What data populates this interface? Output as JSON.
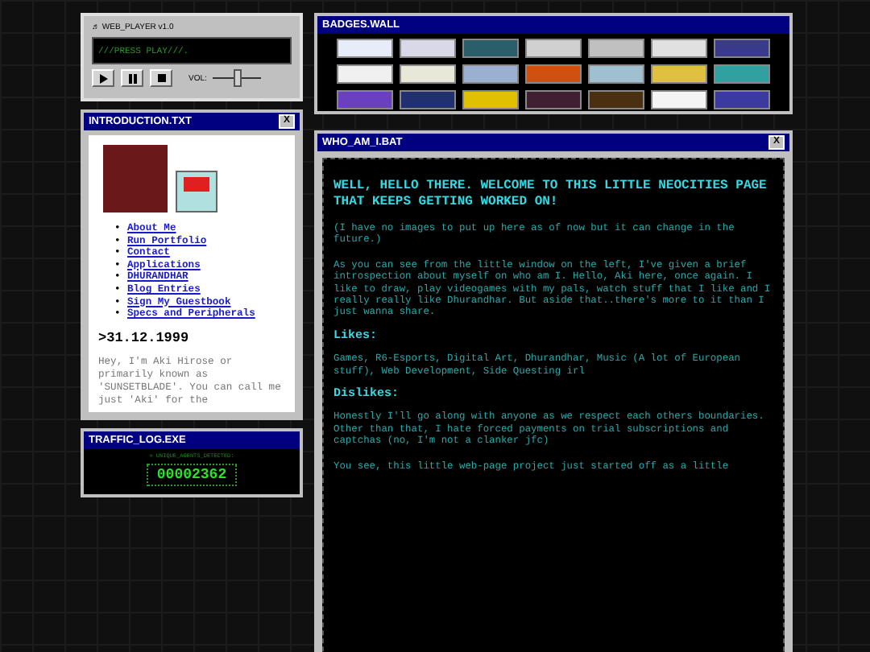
{
  "player": {
    "title": "♬ WEB_PLAYER v1.0",
    "display": "///PRESS PLAY///.",
    "volume_label": "VOL:",
    "volume": {
      "level": 0.5
    }
  },
  "intro": {
    "title": "INTRODUCTION.TXT",
    "close": "X",
    "links": [
      {
        "bullet": "•",
        "label": "About Me"
      },
      {
        "bullet": "•",
        "label": "Run Portfolio"
      },
      {
        "bullet": "•",
        "label": "Contact"
      },
      {
        "bullet": "•",
        "label": "Applications"
      },
      {
        "bullet": "•",
        "label": "DHURANDHAR"
      },
      {
        "bullet": "•",
        "label": "Blog Entries"
      },
      {
        "bullet": "•",
        "label": "Sign My Guestbook"
      },
      {
        "bullet": "•",
        "label": "Specs and Peripherals"
      }
    ],
    "date": ">31.12.1999",
    "text": "Hey, I'm Aki Hirose or primarily known as 'SUNSETBLADE'. You can call me just 'Aki' for the"
  },
  "traffic": {
    "title": "TRAFFIC_LOG.EXE",
    "caption": "» UNIQUE_AGENTS_DETECTED:",
    "count": "00002362"
  },
  "badges": {
    "title": "BADGES.WALL",
    "items": [
      {
        "color": "#e8ecf8"
      },
      {
        "color": "#d8d8e8"
      },
      {
        "color": "#2a5e6a"
      },
      {
        "color": "#d0d0d0"
      },
      {
        "color": "#c0c0c0"
      },
      {
        "color": "#e0e0e0"
      },
      {
        "color": "#3a3a8a"
      },
      {
        "color": "#f0f0f0"
      },
      {
        "color": "#e8e8d8"
      },
      {
        "color": "#9ab0d0"
      },
      {
        "color": "#d05010"
      },
      {
        "color": "#a0c0d0"
      },
      {
        "color": "#e0c040"
      },
      {
        "color": "#30a0a0"
      },
      {
        "color": "#6a40c0"
      },
      {
        "color": "#203070"
      },
      {
        "color": "#e0c000"
      },
      {
        "color": "#402030"
      },
      {
        "color": "#4a3010"
      },
      {
        "color": "#f4f4f4"
      },
      {
        "color": "#3a3aa0"
      }
    ]
  },
  "about": {
    "title": "WHO_AM_I.BAT",
    "close": "X",
    "heading": "WELL, HELLO THERE. WELCOME TO THIS LITTLE NEOCITIES PAGE THAT KEEPS GETTING WORKED ON!",
    "note": "(I have no images to put up here as of now but it can change in the future.)",
    "paragraph": "As you can see from the little window on the left, I've given a brief introspection about myself on who am I. Hello, Aki here, once again. I like to draw, play videogames with my pals, watch stuff that I like and I really really like Dhurandhar. But aside that..there's more to it than I just wanna share.",
    "sections": [
      {
        "heading": "Likes:",
        "text": "Games, R6-Esports, Digital Art, Dhurandhar, Music (A lot of European stuff), Web Development, Side Questing irl"
      },
      {
        "heading": "Dislikes:",
        "text": "Honestly I'll go along with anyone as we respect each others boundaries. Other than that, I hate forced payments on trial subscriptions and captchas (no, I'm not a clanker jfc)"
      }
    ],
    "tail": "You see, this little web-page project just started off as a little"
  }
}
